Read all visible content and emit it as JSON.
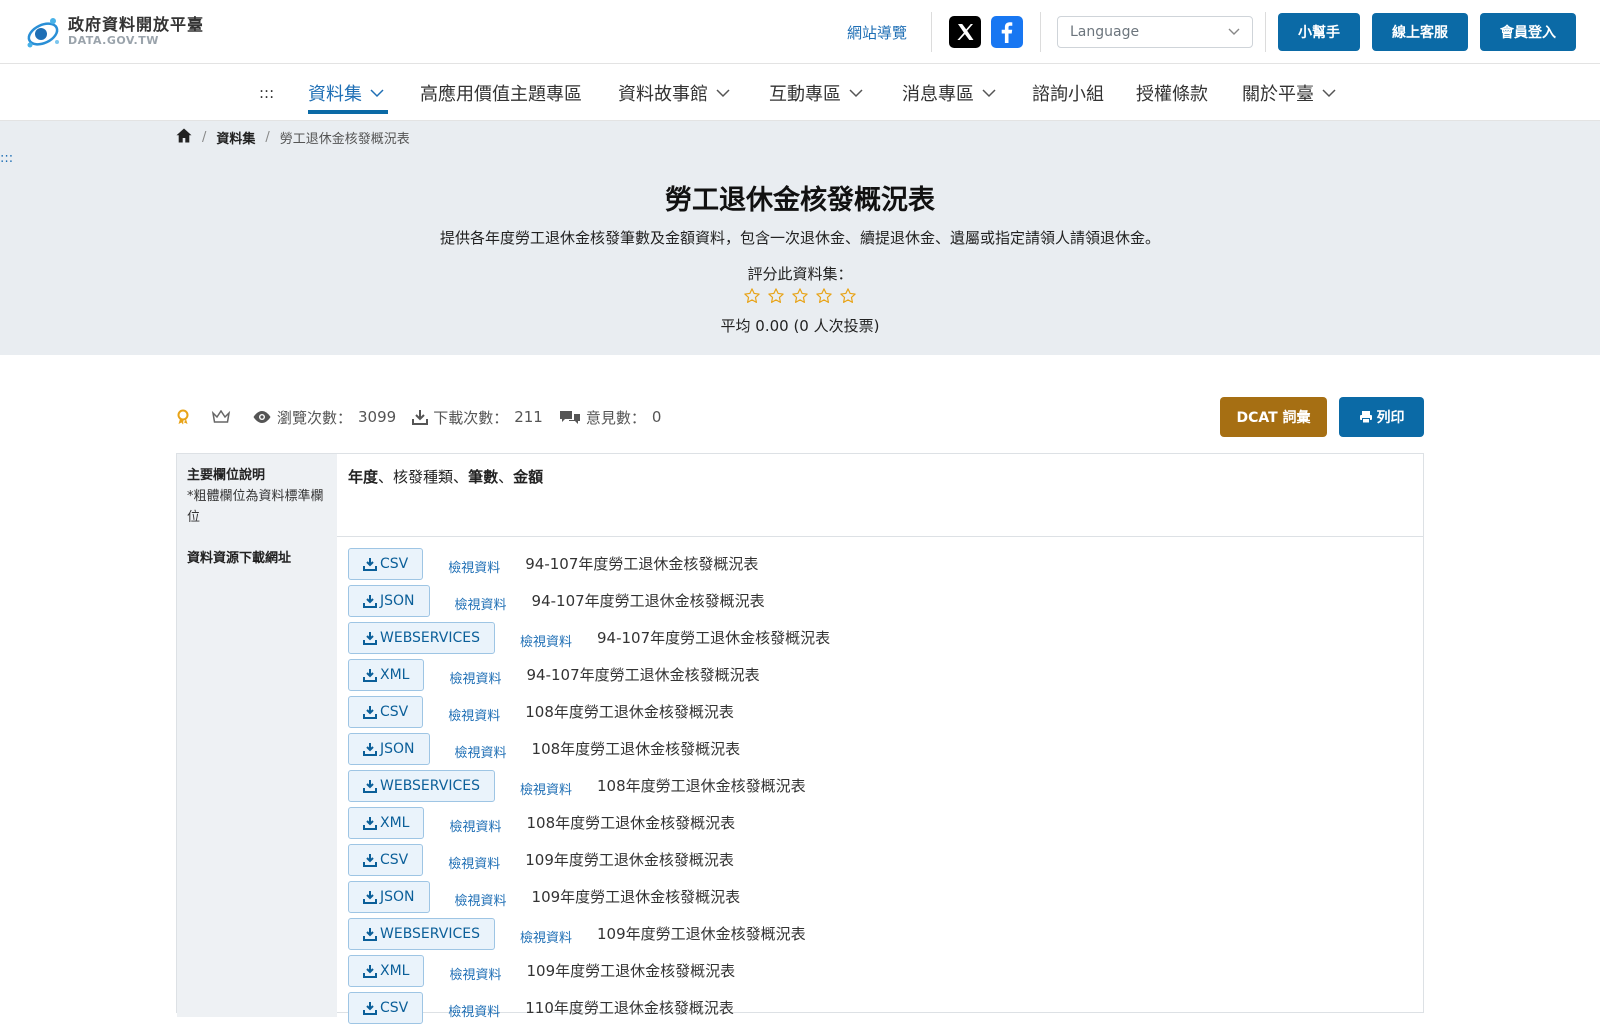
{
  "header": {
    "logo_cn": "政府資料開放平臺",
    "logo_en": "DATA.GOV.TW",
    "sitemap": "網站導覽",
    "language_placeholder": "Language",
    "buttons": {
      "helper": "小幫手",
      "service": "線上客服",
      "login": "會員登入"
    }
  },
  "nav": {
    "skip": ":::",
    "items": [
      {
        "label": "資料集",
        "dropdown": true
      },
      {
        "label": "高應用價值主題專區",
        "dropdown": false
      },
      {
        "label": "資料故事館",
        "dropdown": true
      },
      {
        "label": "互動專區",
        "dropdown": true
      },
      {
        "label": "消息專區",
        "dropdown": true
      },
      {
        "label": "諮詢小組",
        "dropdown": false
      },
      {
        "label": "授權條款",
        "dropdown": false
      },
      {
        "label": "關於平臺",
        "dropdown": true
      }
    ]
  },
  "breadcrumb": {
    "level1": "資料集",
    "current": "勞工退休金核發概況表",
    "sep": "/"
  },
  "hero": {
    "skip": ":::",
    "title": "勞工退休金核發概況表",
    "description": "提供各年度勞工退休金核發筆數及金額資料，包含一次退休金、續提退休金、遺屬或指定請領人請領退休金。",
    "rate_label": "評分此資料集：",
    "star_count": 5,
    "avg_text": "平均 0.00 (0 人次投票)"
  },
  "stats": {
    "views_label": "瀏覽次數：",
    "views": "3099",
    "downloads_label": "下載次數：",
    "downloads": "211",
    "comments_label": "意見數：",
    "comments": "0"
  },
  "actions": {
    "dcat": "DCAT 詞彙",
    "print": "列印"
  },
  "table": {
    "fields_header": "主要欄位說明",
    "fields_note": "*粗體欄位為資料標準欄位",
    "fields": [
      {
        "text": "年度",
        "bold": true
      },
      {
        "text": "、",
        "bold": false
      },
      {
        "text": "核發種類",
        "bold": false
      },
      {
        "text": "、",
        "bold": false
      },
      {
        "text": "筆數",
        "bold": true
      },
      {
        "text": "、",
        "bold": false
      },
      {
        "text": "金額",
        "bold": true
      }
    ],
    "resources_header": "資料資源下載網址",
    "view_label": "檢視資料",
    "resources": [
      {
        "format": "CSV",
        "name": "94-107年度勞工退休金核發概況表"
      },
      {
        "format": "JSON",
        "name": "94-107年度勞工退休金核發概況表"
      },
      {
        "format": "WEBSERVICES",
        "name": "94-107年度勞工退休金核發概況表"
      },
      {
        "format": "XML",
        "name": "94-107年度勞工退休金核發概況表"
      },
      {
        "format": "CSV",
        "name": "108年度勞工退休金核發概況表"
      },
      {
        "format": "JSON",
        "name": "108年度勞工退休金核發概況表"
      },
      {
        "format": "WEBSERVICES",
        "name": "108年度勞工退休金核發概況表"
      },
      {
        "format": "XML",
        "name": "108年度勞工退休金核發概況表"
      },
      {
        "format": "CSV",
        "name": "109年度勞工退休金核發概況表"
      },
      {
        "format": "JSON",
        "name": "109年度勞工退休金核發概況表"
      },
      {
        "format": "WEBSERVICES",
        "name": "109年度勞工退休金核發概況表"
      },
      {
        "format": "XML",
        "name": "109年度勞工退休金核發概況表"
      },
      {
        "format": "CSV",
        "name": "110年度勞工退休金核發概況表"
      }
    ]
  },
  "colors": {
    "primary": "#0b6aa6",
    "dcat": "#a66f13",
    "hero_bg": "#e9edf1",
    "star": "#e8a317"
  }
}
